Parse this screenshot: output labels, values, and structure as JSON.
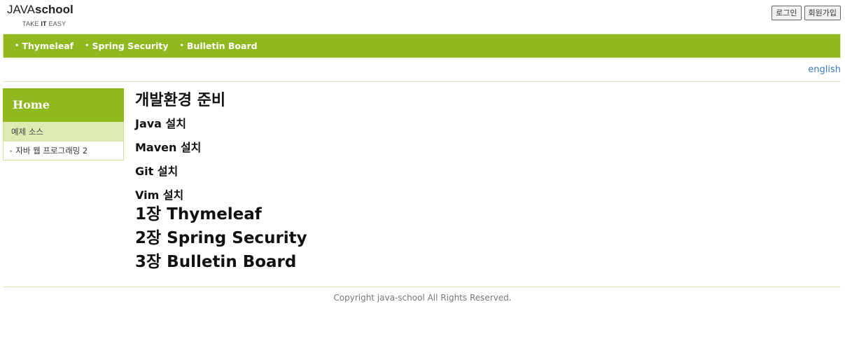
{
  "logo": {
    "brand_plain": "JAVA",
    "brand_bold": "school",
    "tag_pre": "TAKE ",
    "tag_bold": "IT",
    "tag_post": " EASY"
  },
  "auth": {
    "login": "로그인",
    "signup": "회원가입"
  },
  "topnav": [
    {
      "label": "Thymeleaf"
    },
    {
      "label": "Spring Security"
    },
    {
      "label": "Bulletin Board"
    }
  ],
  "lang": "english",
  "sidebar": {
    "home": "Home",
    "section": "예제 소스",
    "links": [
      {
        "label": "자바 웹 프로그래밍 2"
      }
    ]
  },
  "main": {
    "title": "개발환경 준비",
    "subsections": [
      {
        "label": "Java 설치"
      },
      {
        "label": "Maven 설치"
      },
      {
        "label": "Git 설치"
      },
      {
        "label": "Vim 설치"
      }
    ],
    "chapters": [
      {
        "label": "1장 Thymeleaf"
      },
      {
        "label": "2장 Spring Security"
      },
      {
        "label": "3장 Bulletin Board"
      }
    ]
  },
  "footer": "Copyright java-school All Rights Reserved.",
  "colors": {
    "accent": "#8fb91e",
    "accent_light": "#dcebb0",
    "link": "#3b7bbf"
  }
}
